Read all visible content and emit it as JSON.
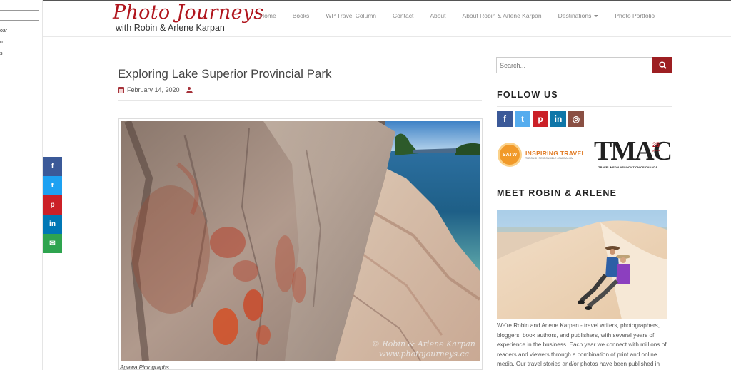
{
  "left_panel": {
    "lines": [
      "oar",
      "u",
      "s"
    ]
  },
  "header": {
    "logo_line1": "Photo Journeys",
    "logo_line2": "with Robin & Arlene Karpan",
    "nav": [
      "Home",
      "Books",
      "WP Travel Column",
      "Contact",
      "About",
      "About Robin & Arlene Karpan",
      "Destinations",
      "Photo Portfolio"
    ]
  },
  "share": [
    {
      "icon": "facebook-icon",
      "glyph": "f",
      "color": "#3b5998"
    },
    {
      "icon": "twitter-icon",
      "glyph": "t",
      "color": "#1da1f2"
    },
    {
      "icon": "pinterest-icon",
      "glyph": "p",
      "color": "#cb2027"
    },
    {
      "icon": "linkedin-icon",
      "glyph": "in",
      "color": "#0077b5"
    },
    {
      "icon": "email-icon",
      "glyph": "✉",
      "color": "#2ea44f"
    }
  ],
  "post": {
    "title": "Exploring Lake Superior Provincial Park",
    "date": "February 14, 2020",
    "watermark_line1": "© Robin & Arlene Karpan",
    "watermark_line2": "www.photojourneys.ca",
    "caption": "Agawa Pictographs"
  },
  "sidebar": {
    "search_placeholder": "Search...",
    "follow_title": "FOLLOW US",
    "social": [
      {
        "icon": "facebook-icon",
        "glyph": "f",
        "color": "#3b5998"
      },
      {
        "icon": "twitter-icon",
        "glyph": "t",
        "color": "#55acee"
      },
      {
        "icon": "pinterest-icon",
        "glyph": "p",
        "color": "#cb2027"
      },
      {
        "icon": "linkedin-icon",
        "glyph": "in",
        "color": "#0e76a8"
      },
      {
        "icon": "instagram-icon",
        "glyph": "◎",
        "color": "#8a4f43"
      }
    ],
    "satw_badge": "SATW",
    "satw_line1": "INSPIRING TRAVEL",
    "satw_line2": "THROUGH RESPONSIBLE JOURNALISM",
    "tmac_text": "TMAC",
    "tmac_number": "25",
    "tmac_years": "years",
    "tmac_sub": "TRAVEL MEDIA ASSOCIATION OF CANADA",
    "meet_title": "MEET ROBIN & ARLENE",
    "about_text": "We're Robin and Arlene Karpan - travel writers, photographers, bloggers, book authors, and publishers, with several years of experience in the business. Each year we connect with millions of readers and viewers through a combination of print and online media. Our travel stories and/or photos have been published in"
  },
  "colors": {
    "brand_red": "#b0151d",
    "button_red": "#9d1f22"
  }
}
